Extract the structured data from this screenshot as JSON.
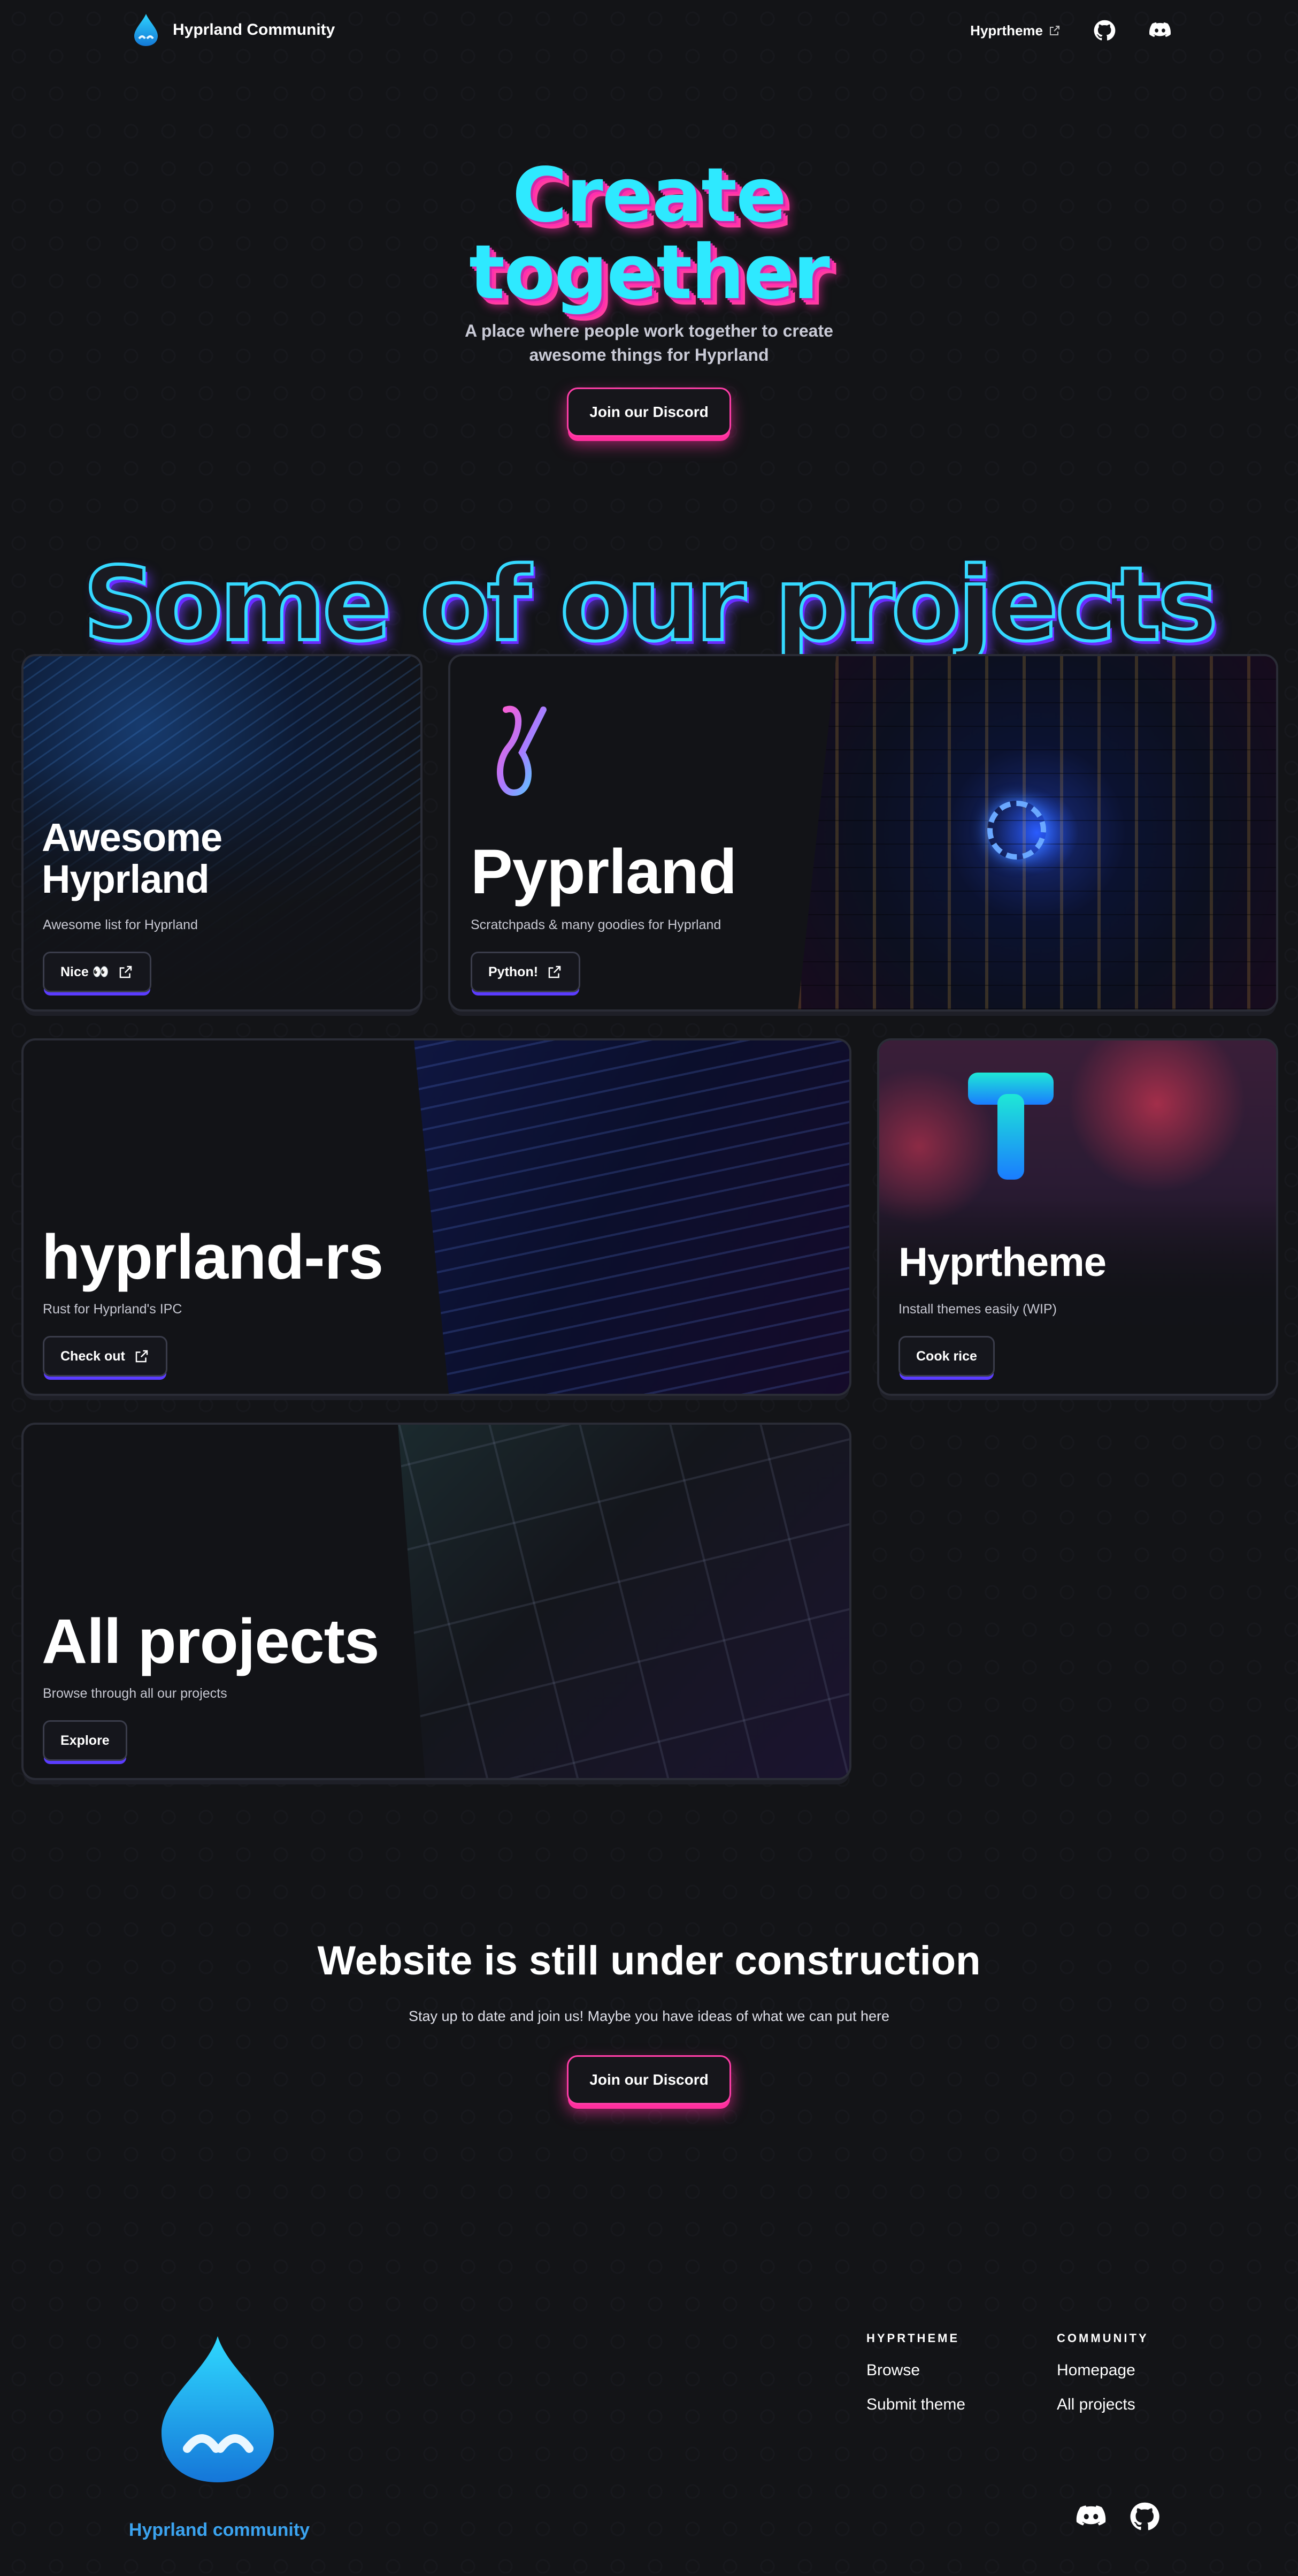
{
  "nav": {
    "brand": "Hyprland Community",
    "links": [
      {
        "label": "Hyprtheme"
      }
    ],
    "icons": [
      "github-icon",
      "discord-icon"
    ]
  },
  "hero": {
    "title_line1": "Create",
    "title_line2": "together",
    "subtitle_line1": "A place where people work together to create",
    "subtitle_line2": "awesome things for Hyprland",
    "cta": "Join our Discord"
  },
  "projects": {
    "heading": "Some of our projects",
    "cards": [
      {
        "title_line1": "Awesome",
        "title_line2": "Hyprland",
        "desc": "Awesome list for Hyprland",
        "button": "Nice 👀"
      },
      {
        "title": "Pyprland",
        "desc": "Scratchpads & many goodies for Hyprland",
        "button": "Python!"
      },
      {
        "title": "hyprland-rs",
        "desc": "Rust for Hyprland's IPC",
        "button": "Check out"
      },
      {
        "title": "Hyprtheme",
        "desc": "Install themes easily (WIP)",
        "button": "Cook rice"
      },
      {
        "title": "All projects",
        "desc": "Browse through all our projects",
        "button": "Explore"
      }
    ]
  },
  "construction": {
    "title": "Website is still under construction",
    "subtitle": "Stay up to date and join us! Maybe you have ideas of what we can put here",
    "cta": "Join our Discord"
  },
  "footer": {
    "name": "Hyprland community",
    "columns": [
      {
        "heading": "HYPRTHEME",
        "links": [
          "Browse",
          "Submit theme"
        ]
      },
      {
        "heading": "COMMUNITY",
        "links": [
          "Homepage",
          "All projects"
        ]
      }
    ],
    "icons": [
      "discord-icon",
      "github-icon"
    ]
  },
  "colors": {
    "background": "#131417",
    "accent_cyan": "#2ee9ff",
    "accent_pink": "#ff3ea8",
    "accent_purple": "#5b3cff",
    "footer_name": "#3ba3ef"
  }
}
